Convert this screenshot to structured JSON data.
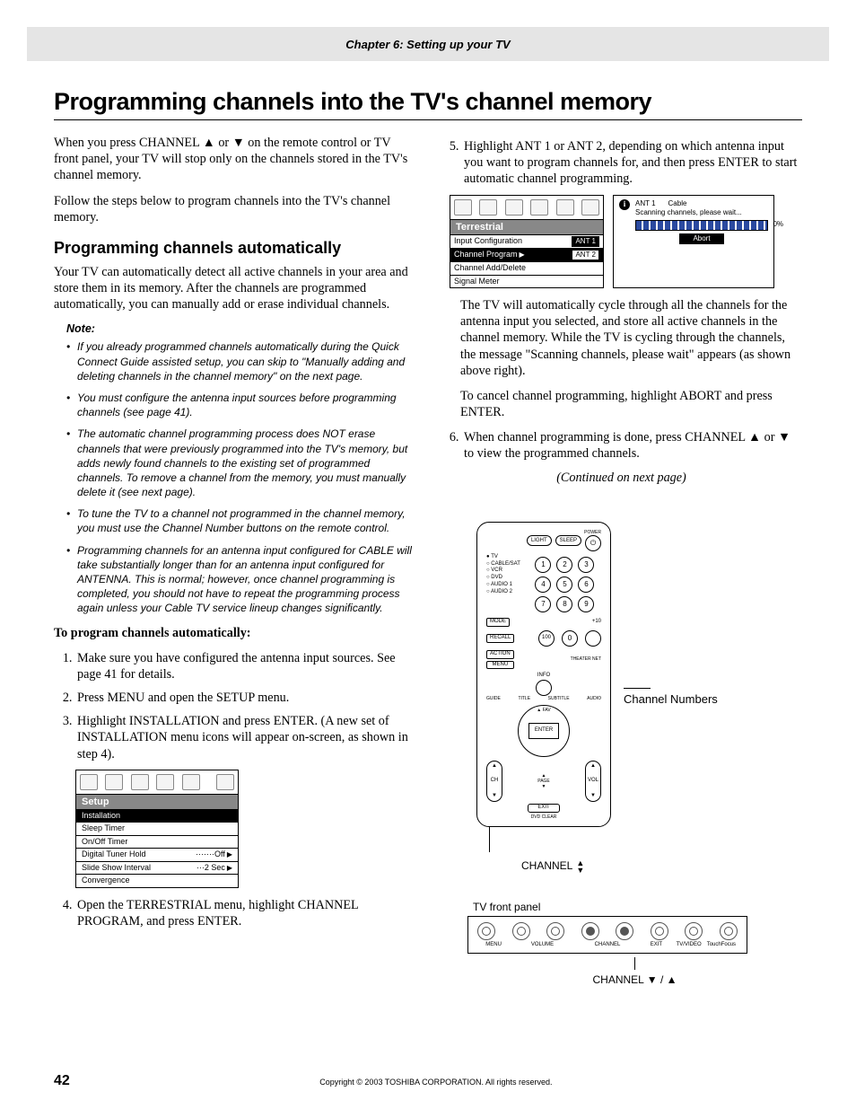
{
  "header": {
    "chapter": "Chapter 6: Setting up your TV"
  },
  "title": "Programming channels into the TV's channel memory",
  "left": {
    "intro1": "When you press CHANNEL ▲ or ▼ on the remote control or TV front panel, your TV will stop only on the channels stored in the TV's channel memory.",
    "intro2": "Follow the steps below to program channels into the TV's channel memory.",
    "sub": "Programming channels automatically",
    "auto_intro": "Your TV can automatically detect all active channels in your area and store them in its memory. After the channels are programmed automatically, you can manually add or erase individual channels.",
    "note_title": "Note:",
    "notes": [
      "If you already programmed channels automatically during the Quick Connect Guide assisted setup, you can skip to \"Manually adding and deleting channels in the channel memory\" on the next page.",
      "You must configure the antenna input sources before programming channels (see page 41).",
      "The automatic channel programming process does NOT erase channels that were previously programmed into the TV's memory, but adds newly found channels to the existing set of programmed channels. To remove a channel from the memory, you must manually delete it (see next page).",
      "To tune the TV to a channel not programmed in the channel memory, you must use the Channel Number buttons on the remote control.",
      "Programming channels for an antenna input configured for CABLE will take substantially longer than for an antenna input configured for ANTENNA. This is normal; however, once channel programming is completed, you should not have to repeat the programming process again unless your Cable TV service lineup changes significantly."
    ],
    "to_program": "To program channels automatically:",
    "steps_a": [
      "Make sure you have configured the antenna input sources. See page 41 for details.",
      "Press MENU and open the SETUP menu.",
      "Highlight INSTALLATION and press ENTER. (A new set of INSTALLATION menu icons will appear on-screen, as shown in step 4)."
    ],
    "setup_menu": {
      "title": "Setup",
      "rows": [
        {
          "label": "Installation",
          "hl": true
        },
        {
          "label": "Sleep Timer"
        },
        {
          "label": "On/Off Timer"
        },
        {
          "label": "Digital Tuner Hold",
          "value": "Off",
          "arrow": true,
          "dots": true
        },
        {
          "label": "Slide Show Interval",
          "value": "2 Sec",
          "arrow": true,
          "dots": true
        },
        {
          "label": "Convergence"
        }
      ]
    },
    "step4": "Open the TERRESTRIAL menu, highlight CHANNEL PROGRAM, and press ENTER."
  },
  "right": {
    "step5": "Highlight ANT 1 or ANT 2, depending on which antenna input you want to program channels for, and then press ENTER to start automatic channel programming.",
    "terr_menu": {
      "title": "Terrestrial",
      "rows": [
        {
          "label": "Input Configuration",
          "ant": "ANT 1",
          "ant_hl": true
        },
        {
          "label": "Channel Program",
          "hl": true,
          "ant": "ANT 2",
          "arrow": true
        },
        {
          "label": "Channel Add/Delete"
        },
        {
          "label": "Signal Meter"
        }
      ]
    },
    "scan": {
      "ant1": "ANT 1",
      "cable": "Cable",
      "msg": "Scanning channels, please wait...",
      "pct": "0%",
      "abort": "Abort"
    },
    "after_scan1": "The TV will automatically cycle through all the channels for the antenna input you selected, and store all active channels in the channel memory. While the TV is cycling through the channels, the message \"Scanning channels, please wait\" appears (as shown above right).",
    "after_scan2": "To cancel channel programming, highlight ABORT and press ENTER.",
    "step6": "When channel programming is done, press CHANNEL ▲ or ▼ to view the programmed channels.",
    "continued": "(Continued on next page)",
    "remote_label": "Channel Numbers",
    "channel_lbl": "CHANNEL",
    "front_panel": {
      "title": "TV front panel",
      "labels": [
        "MENU",
        "VOLUME",
        "CHANNEL",
        "EXIT",
        "TV/VIDEO",
        "TouchFocus"
      ],
      "chan": "CHANNEL ▼ / ▲"
    }
  },
  "remote": {
    "devices": [
      "TV",
      "CABLE/SAT",
      "VCR",
      "DVD",
      "AUDIO 1",
      "AUDIO 2"
    ],
    "top_btns": [
      "LIGHT",
      "SLEEP"
    ],
    "power": "POWER",
    "mode": "MODE",
    "recall": "RECALL",
    "action": "ACTION",
    "menu": "MENU",
    "info": "INFO",
    "guide": "GUIDE",
    "fav": "▲ FAV",
    "enter": "ENTER",
    "exit": "EXIT",
    "theater": "THEATER NET",
    "ch": "CH",
    "vol": "VOL",
    "page": "PAGE",
    "footer": "DVD CLEAR",
    "arc": [
      "TITLE",
      "SUBTITLE",
      "AUDIO"
    ]
  },
  "footer": {
    "page": "42",
    "copyright": "Copyright © 2003 TOSHIBA CORPORATION. All rights reserved."
  }
}
